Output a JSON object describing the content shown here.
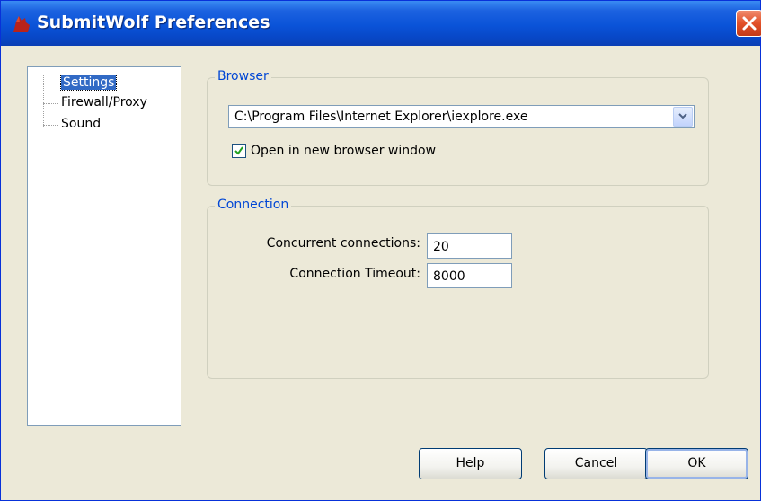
{
  "window": {
    "title": "SubmitWolf Preferences"
  },
  "tree": {
    "items": [
      {
        "label": "Settings",
        "selected": true
      },
      {
        "label": "Firewall/Proxy",
        "selected": false
      },
      {
        "label": "Sound",
        "selected": false
      }
    ]
  },
  "browser_group": {
    "title": "Browser",
    "browser_path": "C:\\Program Files\\Internet Explorer\\iexplore.exe",
    "open_new_window_label": "Open in new browser window",
    "open_new_window_checked": true
  },
  "connection_group": {
    "title": "Connection",
    "concurrent_label": "Concurrent connections:",
    "concurrent_value": "20",
    "timeout_label": "Connection Timeout:",
    "timeout_value": "8000"
  },
  "buttons": {
    "help": "Help",
    "cancel": "Cancel",
    "ok": "OK"
  },
  "colors": {
    "titlebar": "#0a53d8",
    "group_title": "#0046d5",
    "selection": "#316ac5",
    "dialog_bg": "#ece9d8"
  }
}
